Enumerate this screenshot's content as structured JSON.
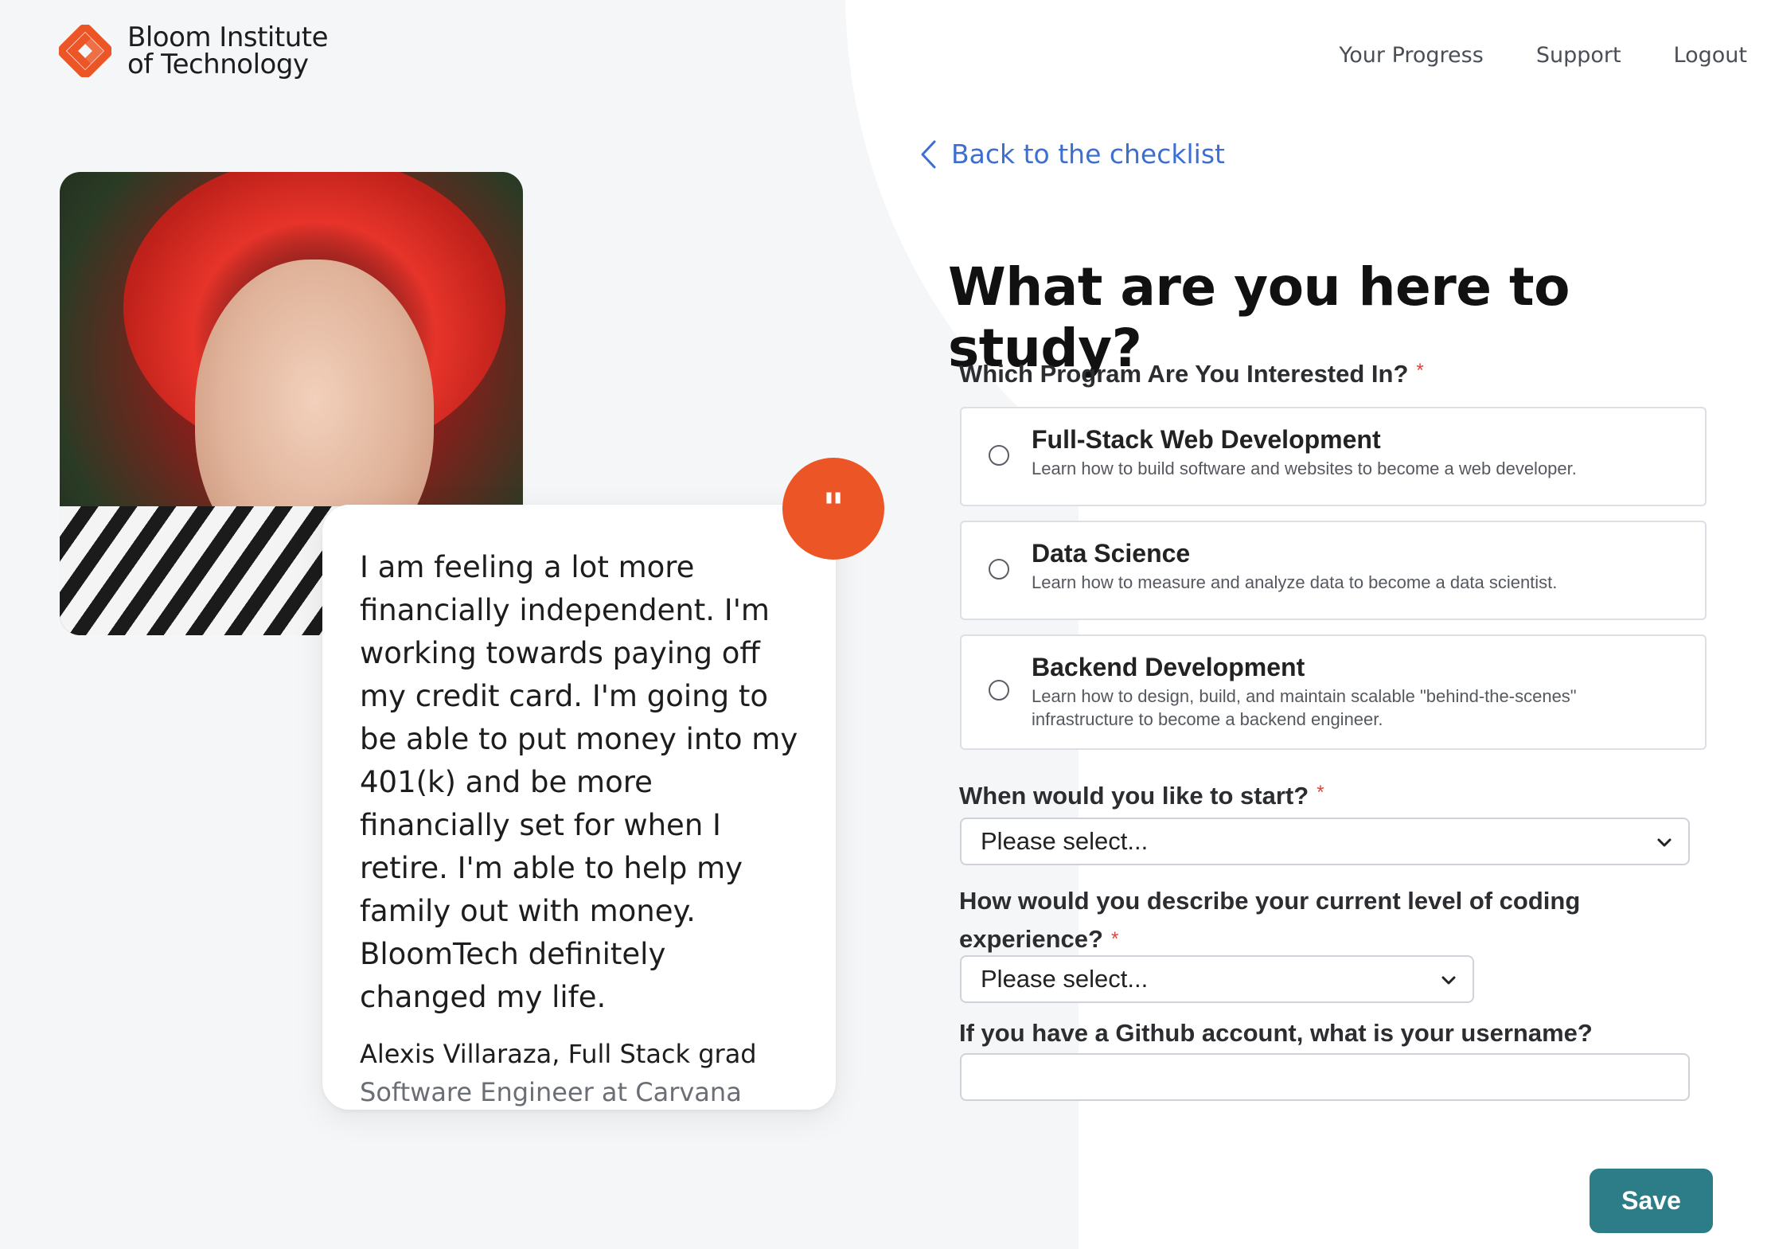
{
  "brand": {
    "line1": "Bloom Institute",
    "line2": "of Technology",
    "accent": "#ec5627"
  },
  "nav": {
    "items": [
      "Your Progress",
      "Support",
      "Logout"
    ]
  },
  "testimonial": {
    "quote_mark": "\"",
    "text": "I am feeling a lot more financially independent. I'm working towards paying off my credit card. I'm going to be able to put money into my 401(k) and be more financially set for when I retire. I'm able to help my family out with money. BloomTech definitely changed my life.",
    "author": "Alexis Villaraza, Full Stack grad",
    "role": "Software Engineer at Carvana"
  },
  "form": {
    "back_label": "Back to the checklist",
    "heading": "What are you here to study?",
    "program_label": "Which Program Are You Interested In?",
    "required_mark": "*",
    "programs": [
      {
        "title": "Full-Stack Web Development",
        "description": "Learn how to build software and websites to become a web developer."
      },
      {
        "title": "Data Science",
        "description": "Learn how to measure and analyze data to become a data scientist."
      },
      {
        "title": "Backend Development",
        "description": "Learn how to design, build, and maintain scalable \"behind-the-scenes\" infrastructure to become a backend engineer."
      }
    ],
    "start_label": "When would you like to start?",
    "start_value": "Please select...",
    "experience_label_1": "How would you describe your current level of coding",
    "experience_label_2": "experience?",
    "experience_value": "Please select...",
    "github_label": "If you have a Github account, what is your username?",
    "github_value": "",
    "save_label": "Save",
    "save_color": "#2c7d87",
    "link_color": "#3c6fd1"
  }
}
